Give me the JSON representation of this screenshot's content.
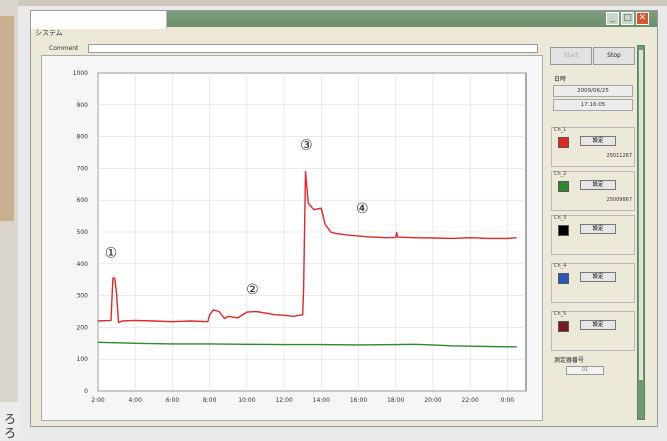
{
  "window": {
    "menu_label": "システム",
    "comment_label": "Comment",
    "comment_value": ""
  },
  "toolbar": {
    "start_label": "Start",
    "stop_label": "Stop"
  },
  "info": {
    "datetime_label": "日時",
    "date": "2009/06/25",
    "time": "17:16:05",
    "measurement_no_label": "測定器番号",
    "measurement_no_value": "01"
  },
  "channels": [
    {
      "name": "Ch_1",
      "set_label": "設定",
      "id": "25011267",
      "color": "#e42727"
    },
    {
      "name": "Ch_2",
      "set_label": "設定",
      "id": "25009867",
      "color": "#2b8a2b"
    },
    {
      "name": "Ch_3",
      "set_label": "設定",
      "id": "",
      "color": "#000000"
    },
    {
      "name": "Ch_4",
      "set_label": "設定",
      "id": "",
      "color": "#2a57b8"
    },
    {
      "name": "Ch_5",
      "set_label": "設定",
      "id": "",
      "color": "#7a1a1a"
    }
  ],
  "background": {
    "marks": [
      "ろ",
      "ろ"
    ]
  },
  "chart_data": {
    "type": "line",
    "xlim": [
      2,
      25
    ],
    "ylim": [
      0,
      1000
    ],
    "x_ticks": [
      2,
      4,
      6,
      8,
      10,
      12,
      14,
      16,
      18,
      20,
      22,
      24
    ],
    "x_tick_labels": [
      "2:00",
      "4:00",
      "6:00",
      "8:00",
      "10:00",
      "12:00",
      "14:00",
      "16:00",
      "18:00",
      "20:00",
      "22:00",
      "0:00"
    ],
    "y_ticks": [
      0,
      100,
      200,
      300,
      400,
      500,
      600,
      700,
      800,
      900,
      1000
    ],
    "y_tick_labels": [
      "0",
      "100",
      "200",
      "300",
      "400",
      "500",
      "600",
      "700",
      "800",
      "900",
      "1000"
    ],
    "grid": true,
    "series": [
      {
        "color": "#e42727",
        "x": [
          2,
          2.7,
          2.8,
          2.9,
          3.0,
          3.1,
          3.3,
          4.0,
          5.0,
          6.0,
          7.0,
          7.9,
          8.0,
          8.2,
          8.5,
          8.8,
          9.0,
          9.5,
          10.0,
          10.5,
          11.0,
          11.5,
          12.0,
          12.5,
          13.0,
          13.05,
          13.15,
          13.3,
          13.6,
          14.0,
          14.2,
          14.5,
          14.8,
          15.5,
          16.5,
          17.5,
          18.0,
          18.05,
          18.1,
          19.0,
          20.0,
          21.0,
          22.0,
          23.0,
          24.0,
          24.5
        ],
        "y": [
          220,
          222,
          355,
          355,
          305,
          215,
          220,
          222,
          220,
          218,
          220,
          218,
          240,
          255,
          250,
          228,
          235,
          230,
          248,
          250,
          245,
          240,
          238,
          235,
          240,
          320,
          690,
          590,
          570,
          575,
          525,
          500,
          495,
          490,
          485,
          482,
          483,
          498,
          484,
          482,
          481,
          480,
          482,
          480,
          480,
          482
        ]
      },
      {
        "color": "#2b8a2b",
        "x": [
          2,
          4,
          6,
          8,
          10,
          12,
          14,
          16,
          18,
          19,
          20,
          21,
          22,
          23,
          24,
          24.5
        ],
        "y": [
          153,
          150,
          148,
          148,
          147,
          146,
          146,
          145,
          146,
          147,
          145,
          142,
          141,
          140,
          139,
          139
        ]
      }
    ],
    "annotations": [
      {
        "text": "①",
        "x": 2.7,
        "y": 420
      },
      {
        "text": "②",
        "x": 10.3,
        "y": 305
      },
      {
        "text": "③",
        "x": 13.2,
        "y": 760
      },
      {
        "text": "④",
        "x": 16.2,
        "y": 560
      }
    ]
  }
}
